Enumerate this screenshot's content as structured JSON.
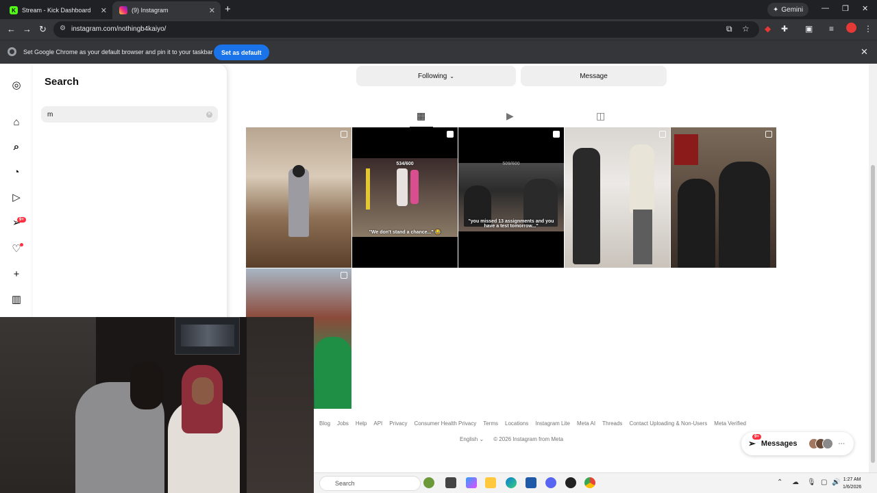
{
  "browser": {
    "tabs": [
      {
        "title": "Stream - Kick Dashboard",
        "favicon": "K",
        "active": false
      },
      {
        "title": "(9) Instagram",
        "favicon": "instagram-icon",
        "active": true
      }
    ],
    "gemini_label": "Gemini",
    "url": "instagram.com/nothingb4kaiyo/",
    "infobar_message": "Set Google Chrome as your default browser and pin it to your taskbar",
    "set_default_label": "Set as default"
  },
  "search_panel": {
    "title": "Search",
    "query": "m"
  },
  "nav_badges": {
    "reels_badge": "9+"
  },
  "profile": {
    "following_label": "Following",
    "message_label": "Message"
  },
  "posts": [
    {
      "caption": ""
    },
    {
      "caption": "\"We don't stand a chance...\" 😂",
      "counter": "534/600"
    },
    {
      "caption": "\"you missed 13 assignments and you have a test tomorrow...\"",
      "counter": "509/600"
    },
    {
      "caption": ""
    },
    {
      "caption": ""
    },
    {
      "caption": ""
    }
  ],
  "footer": {
    "links": [
      "Blog",
      "Jobs",
      "Help",
      "API",
      "Privacy",
      "Consumer Health Privacy",
      "Terms",
      "Locations",
      "Instagram Lite",
      "Meta AI",
      "Threads",
      "Contact Uploading & Non-Users",
      "Meta Verified"
    ],
    "language": "English",
    "copyright": "© 2026 Instagram from Meta"
  },
  "messages": {
    "label": "Messages",
    "badge": "9+"
  },
  "taskbar": {
    "search_placeholder": "Search",
    "time": "1:27 AM",
    "date": "1/6/2026"
  },
  "colors": {
    "chrome_dark": "#202124",
    "chrome_toolbar": "#35363a",
    "accent_blue": "#1a73e8",
    "notification_red": "#ff3040"
  }
}
